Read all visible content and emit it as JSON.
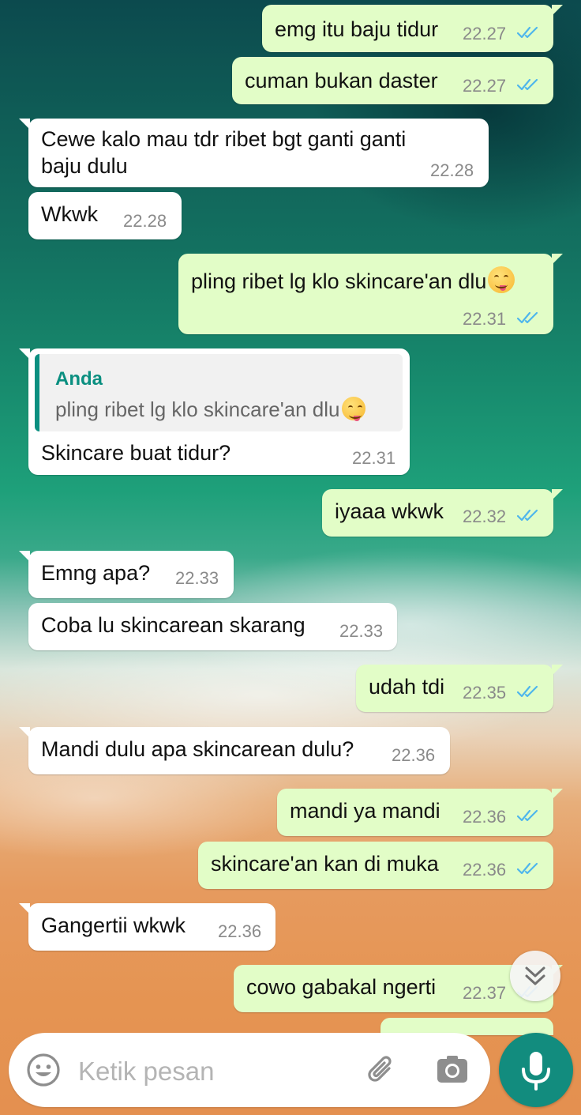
{
  "messages": [
    {
      "text": "emg itu baju tidur",
      "time": "22.27",
      "dir": "out",
      "status": "read"
    },
    {
      "text": "cuman bukan daster",
      "time": "22.27",
      "dir": "out",
      "status": "read"
    },
    {
      "line1": "Cewe kalo mau tdr ribet bgt ganti ganti",
      "line2": "baju dulu",
      "time": "22.28",
      "dir": "in"
    },
    {
      "text": "Wkwk",
      "time": "22.28",
      "dir": "in"
    },
    {
      "text": "pling ribet lg klo skincare'an dlu",
      "time": "22.31",
      "dir": "out",
      "status": "read",
      "emoji": "face-savoring-food"
    },
    {
      "quote_name": "Anda",
      "quote_text": "pling ribet lg klo skincare'an dlu",
      "text": "Skincare buat tidur?",
      "time": "22.31",
      "dir": "in"
    },
    {
      "text": "iyaaa wkwk",
      "time": "22.32",
      "dir": "out",
      "status": "read"
    },
    {
      "text": "Emng apa?",
      "time": "22.33",
      "dir": "in"
    },
    {
      "text": "Coba lu skincarean skarang",
      "time": "22.33",
      "dir": "in"
    },
    {
      "text": "udah tdi",
      "time": "22.35",
      "dir": "out",
      "status": "read"
    },
    {
      "text": "Mandi dulu apa skincarean dulu?",
      "time": "22.36",
      "dir": "in"
    },
    {
      "text": "mandi ya mandi",
      "time": "22.36",
      "dir": "out",
      "status": "read"
    },
    {
      "text": "skincare'an kan di muka",
      "time": "22.36",
      "dir": "out",
      "status": "read"
    },
    {
      "text": "Gangertii wkwk",
      "time": "22.36",
      "dir": "in"
    },
    {
      "text": "cowo gabakal ngerti",
      "time": "22.37",
      "dir": "out",
      "status": "read"
    }
  ],
  "input": {
    "placeholder": "Ketik pesan"
  },
  "icons": {
    "emoji": "emoji-icon",
    "attach": "paperclip-icon",
    "camera": "camera-icon",
    "mic": "microphone-icon",
    "scroll": "double-chevron-down-icon",
    "read_status": "double-check-icon"
  },
  "colors": {
    "outgoing_bubble": "#e2fdc7",
    "incoming_bubble": "#ffffff",
    "read_ticks": "#4fb6ec",
    "accent": "#128c7e",
    "quote_name": "#0a8f80"
  }
}
